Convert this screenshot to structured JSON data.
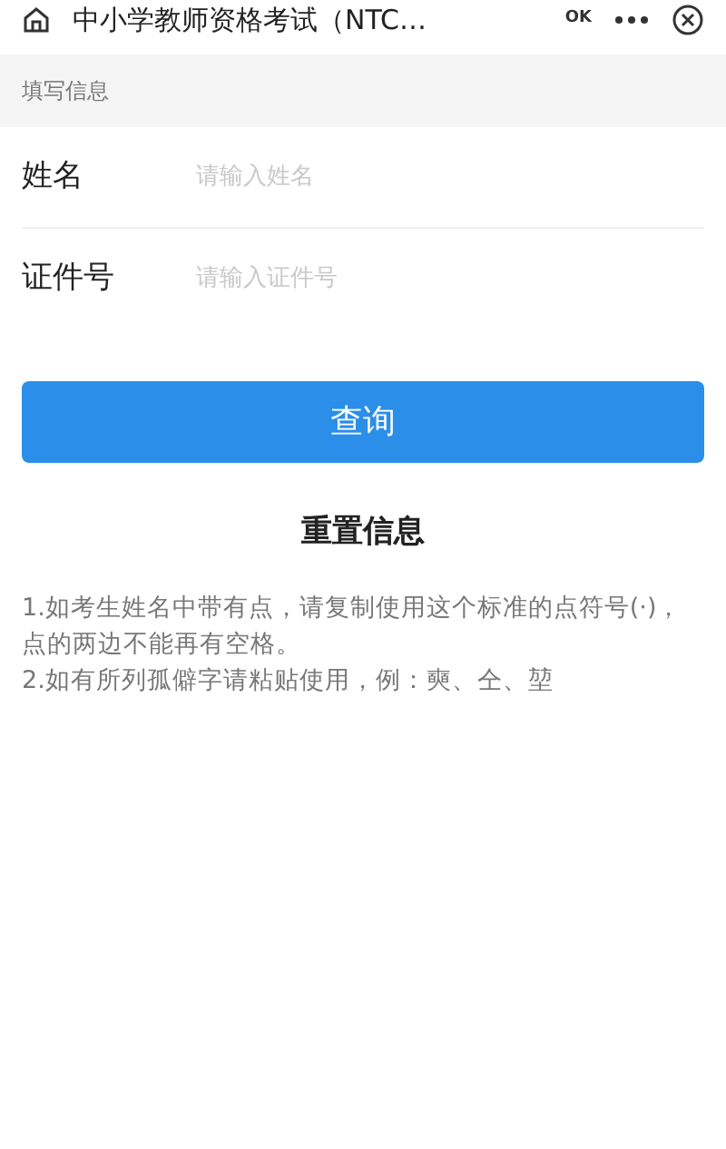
{
  "header": {
    "title": "中小学教师资格考试（NTC…",
    "ok_label": "OK"
  },
  "section": {
    "title": "填写信息"
  },
  "fields": [
    {
      "label": "姓名",
      "placeholder": "请输入姓名"
    },
    {
      "label": "证件号",
      "placeholder": "请输入证件号"
    }
  ],
  "query_button": "查询",
  "reset_button": "重置信息",
  "notes": [
    "1.如考生姓名中带有点，请复制使用这个标准的点符号(·)，点的两边不能再有空格。",
    "2.如有所列孤僻字请粘贴使用，例：奭、仝、堃"
  ]
}
